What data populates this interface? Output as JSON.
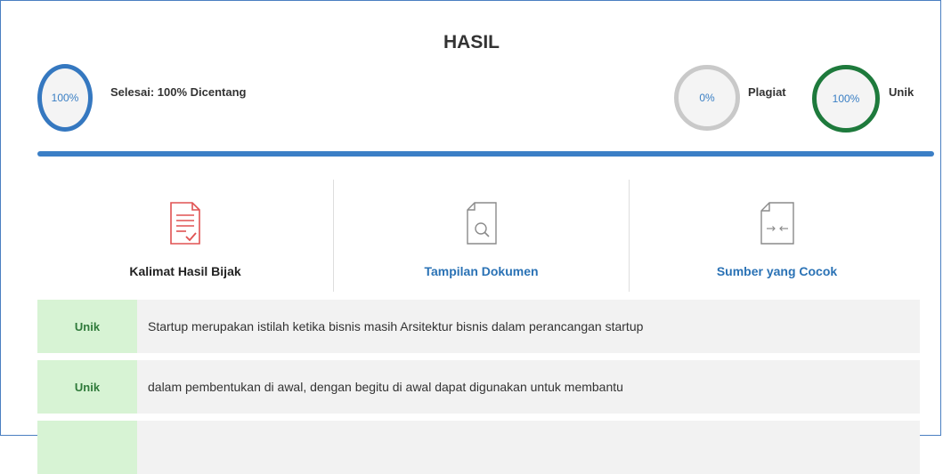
{
  "header": {
    "title": "HASIL"
  },
  "progress": {
    "done_percent_text": "100%",
    "done_label": "Selesai: 100% Dicentang",
    "done_value": 100
  },
  "scores": {
    "plagiat_percent_text": "0%",
    "plagiat_label": "Plagiat",
    "unik_percent_text": "100%",
    "unik_label": "Unik"
  },
  "tabs": [
    {
      "label": "Kalimat Hasil Bijak",
      "icon": "document-check-icon",
      "color": "#e05252"
    },
    {
      "label": "Tampilan Dokumen",
      "icon": "document-search-icon",
      "color": "#888888"
    },
    {
      "label": "Sumber yang Cocok",
      "icon": "document-compare-icon",
      "color": "#888888"
    }
  ],
  "results": [
    {
      "badge": "Unik",
      "text": "Startup merupakan istilah ketika bisnis masih Arsitektur bisnis dalam perancangan startup"
    },
    {
      "badge": "Unik",
      "text": "dalam pembentukan di awal, dengan begitu di awal dapat digunakan untuk membantu"
    },
    {
      "badge": "",
      "text": ""
    }
  ],
  "colors": {
    "accent_blue": "#3b7fc6",
    "unik_green": "#1e7a3c",
    "badge_green_bg": "#d7f3d4",
    "plagiat_gray": "#c9c9c9"
  }
}
